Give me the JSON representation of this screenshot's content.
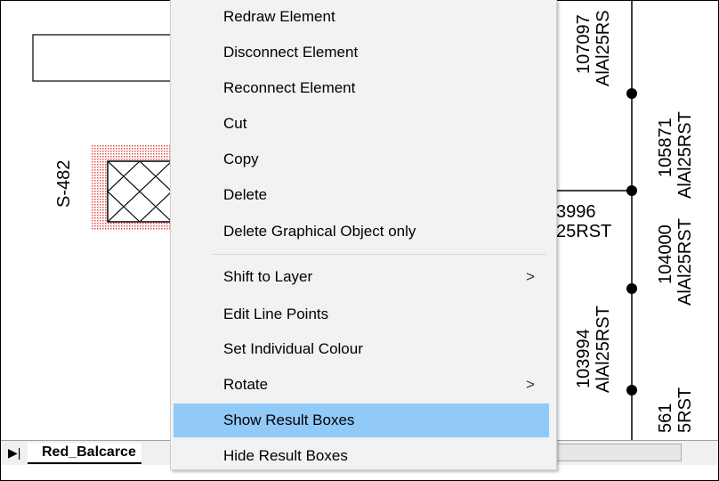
{
  "context_menu": {
    "items": [
      {
        "label": "Redraw Element",
        "submenu": false,
        "highlighted": false
      },
      {
        "label": "Disconnect Element",
        "submenu": false,
        "highlighted": false
      },
      {
        "label": "Reconnect Element",
        "submenu": false,
        "highlighted": false
      },
      {
        "label": "Cut",
        "submenu": false,
        "highlighted": false
      },
      {
        "label": "Copy",
        "submenu": false,
        "highlighted": false
      },
      {
        "label": "Delete",
        "submenu": false,
        "highlighted": false
      },
      {
        "label": "Delete Graphical Object only",
        "submenu": false,
        "highlighted": false
      },
      {
        "label": "Shift to Layer",
        "submenu": true,
        "highlighted": false
      },
      {
        "label": "Edit Line Points",
        "submenu": false,
        "highlighted": false
      },
      {
        "label": "Set Individual Colour",
        "submenu": false,
        "highlighted": false
      },
      {
        "label": "Rotate",
        "submenu": true,
        "highlighted": false
      },
      {
        "label": "Show Result Boxes",
        "submenu": false,
        "highlighted": true
      },
      {
        "label": "Hide Result Boxes",
        "submenu": false,
        "highlighted": false
      }
    ],
    "submenu_arrow": ">"
  },
  "diagram": {
    "switch_label": "S-482",
    "labels": {
      "l107097_id": "107097",
      "l107097_type": "AlAl25RS",
      "l105871_id": "105871",
      "l105871_type": "AlAl25RST",
      "l104000_id": "104000",
      "l104000_type": "AlAl25RST",
      "l103996_id": "3996",
      "l103996_type": "25RST",
      "l103994_id": "103994",
      "l103994_type": "AlAl25RST",
      "l561_id": "561",
      "l561_type": "5RST"
    },
    "colors": {
      "line": "#000000",
      "selection_hatch": "#e05050",
      "menu_highlight": "#91c9f7"
    }
  },
  "tabs": {
    "active_tab": "Red_Balcarce",
    "nav_glyph": "▶|"
  }
}
